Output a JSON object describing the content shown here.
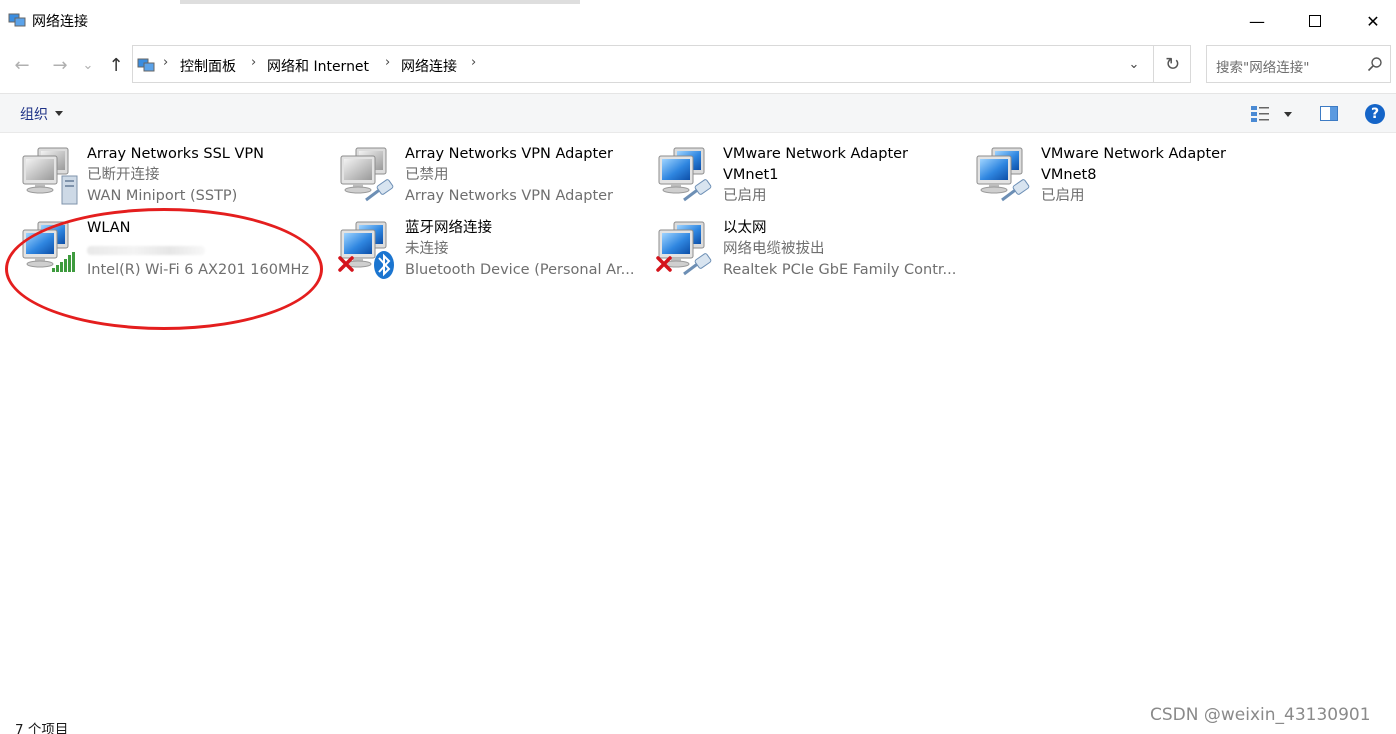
{
  "window": {
    "title": "网络连接",
    "minimize": "—",
    "close": "✕"
  },
  "nav": {
    "back": "←",
    "forward": "→",
    "recent": "⌄",
    "up": "↑",
    "breadcrumbs": [
      "控制面板",
      "网络和 Internet",
      "网络连接"
    ],
    "separator": "›",
    "dropdown": "⌄",
    "refresh": "↻",
    "search_placeholder": "搜索\"网络连接\""
  },
  "toolbar": {
    "organize_label": "组织",
    "help": "?"
  },
  "connections": [
    {
      "name": "Array Networks SSL VPN",
      "status": "已断开连接",
      "device": "WAN Miniport (SSTP)",
      "icon": "network-adapter-icon",
      "overlay": "server-icon",
      "error": false
    },
    {
      "name": "Array Networks VPN Adapter",
      "status": "已禁用",
      "device": "Array Networks VPN Adapter",
      "icon": "network-adapter-icon",
      "overlay": "cable-icon",
      "error": false
    },
    {
      "name": "VMware Network Adapter",
      "name2": "VMnet1",
      "status": "已启用",
      "icon": "network-adapter-icon",
      "overlay": "cable-icon",
      "error": false
    },
    {
      "name": "VMware Network Adapter",
      "name2": "VMnet8",
      "status": "已启用",
      "icon": "network-adapter-icon",
      "overlay": "cable-icon",
      "error": false
    },
    {
      "name": "WLAN",
      "status": "HONOR ...40.34",
      "device": "Intel(R) Wi-Fi 6 AX201 160MHz",
      "icon": "network-adapter-icon",
      "overlay": "wifi-signal-icon",
      "error": false
    },
    {
      "name": "蓝牙网络连接",
      "status": "未连接",
      "device": "Bluetooth Device (Personal Ar...",
      "icon": "network-adapter-icon",
      "overlay": "bluetooth-icon",
      "error": true
    },
    {
      "name": "以太网",
      "status": "网络电缆被拔出",
      "device": "Realtek PCIe GbE Family Contr...",
      "icon": "network-adapter-icon",
      "overlay": "cable-icon",
      "error": true
    }
  ],
  "statusbar": {
    "count": "7 个项目"
  },
  "watermark": "CSDN @weixin_43130901",
  "colors": {
    "highlight_circle": "#e41e1e",
    "link_text": "#1e3287",
    "help_blue": "#1565c8"
  }
}
